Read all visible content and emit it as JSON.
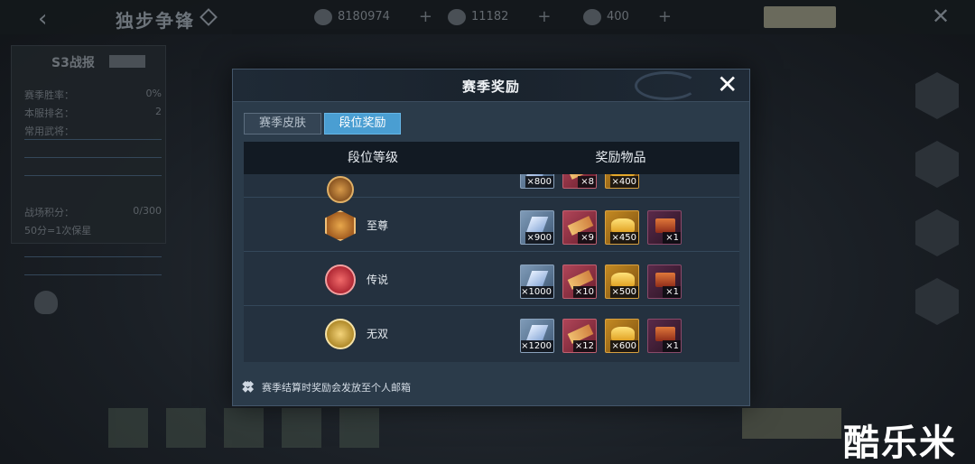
{
  "background": {
    "title": "独步争锋",
    "resources": [
      {
        "icon": "coin-icon",
        "value": "8180974"
      },
      {
        "icon": "gold-ingot-icon",
        "value": "11182"
      },
      {
        "icon": "crystal-icon",
        "value": "400"
      }
    ],
    "panel": {
      "title": "S3战报",
      "rows": [
        {
          "label": "赛季胜率：",
          "value": "0%"
        },
        {
          "label": "本服排名：",
          "value": "2"
        },
        {
          "label": "常用武将：",
          "value": ""
        },
        {
          "label": "战场积分：",
          "value": "0/300"
        },
        {
          "label": "50分=1次保星",
          "value": ""
        }
      ]
    },
    "watermark": "酷乐米"
  },
  "modal": {
    "title": "赛季奖励",
    "tabs": [
      {
        "label": "赛季皮肤",
        "active": false
      },
      {
        "label": "段位奖励",
        "active": true
      }
    ],
    "columns": [
      "段位等级",
      "奖励物品"
    ],
    "partial_row": {
      "items": [
        {
          "type": "crystal",
          "qty": "×800"
        },
        {
          "type": "scroll",
          "qty": "×8"
        },
        {
          "type": "gold",
          "qty": "×400"
        }
      ]
    },
    "rows": [
      {
        "rank": "至尊",
        "medal_icon": "supreme-medal-icon",
        "items": [
          {
            "type": "crystal",
            "qty": "×900"
          },
          {
            "type": "scroll",
            "qty": "×9"
          },
          {
            "type": "gold",
            "qty": "×450"
          },
          {
            "type": "box",
            "qty": "×1"
          }
        ]
      },
      {
        "rank": "传说",
        "medal_icon": "legend-medal-icon",
        "items": [
          {
            "type": "crystal",
            "qty": "×1000"
          },
          {
            "type": "scroll",
            "qty": "×10"
          },
          {
            "type": "gold",
            "qty": "×500"
          },
          {
            "type": "box",
            "qty": "×1"
          }
        ]
      },
      {
        "rank": "无双",
        "medal_icon": "peerless-medal-icon",
        "items": [
          {
            "type": "crystal",
            "qty": "×1200"
          },
          {
            "type": "scroll",
            "qty": "×12"
          },
          {
            "type": "gold",
            "qty": "×600"
          },
          {
            "type": "box",
            "qty": "×1"
          }
        ]
      }
    ],
    "footnote": "赛季结算时奖励会发放至个人邮箱"
  },
  "colors": {
    "modal_bg": "#2b3b4a",
    "active_tab": "#4a9ed2",
    "table_header": "#121a23"
  }
}
